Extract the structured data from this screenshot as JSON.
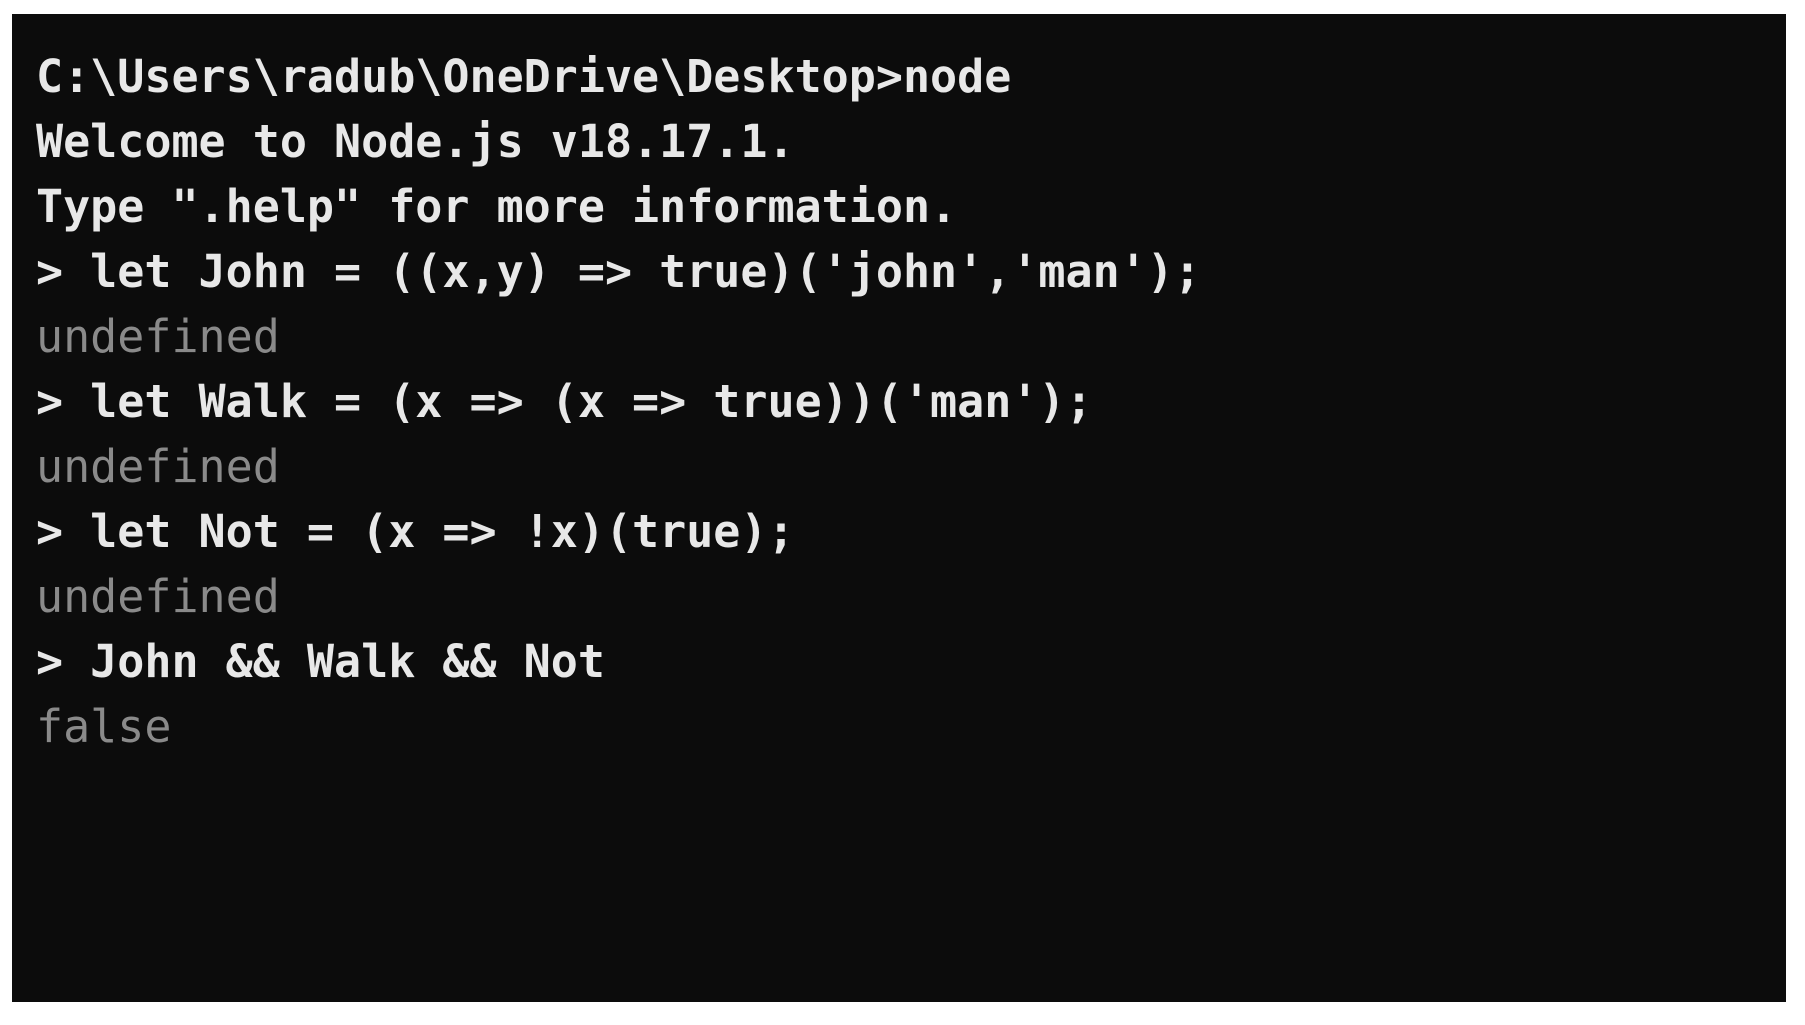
{
  "window": {
    "app": "Command Prompt",
    "background_color": "#0c0c0c",
    "foreground_color": "#e8e8e8",
    "muted_color": "#8a8a8a",
    "page_background": "#ffffff"
  },
  "terminal": {
    "lines": [
      {
        "id": "line-1",
        "kind": "header",
        "text": "C:\\Users\\radub\\OneDrive\\Desktop>node"
      },
      {
        "id": "line-2",
        "kind": "header",
        "text": "Welcome to Node.js v18.17.1."
      },
      {
        "id": "line-3",
        "kind": "header",
        "text": "Type \".help\" for more information."
      },
      {
        "id": "line-4",
        "kind": "prompt",
        "text": "> let John = ((x,y) => true)('john','man');"
      },
      {
        "id": "line-5",
        "kind": "output",
        "text": "undefined"
      },
      {
        "id": "line-6",
        "kind": "prompt",
        "text": "> let Walk = (x => (x => true))('man');"
      },
      {
        "id": "line-7",
        "kind": "output",
        "text": "undefined"
      },
      {
        "id": "line-8",
        "kind": "prompt",
        "text": "> let Not = (x => !x)(true);"
      },
      {
        "id": "line-9",
        "kind": "output",
        "text": "undefined"
      },
      {
        "id": "line-10",
        "kind": "prompt",
        "text": "> John && Walk && Not"
      },
      {
        "id": "line-11",
        "kind": "output",
        "text": "false"
      }
    ]
  }
}
